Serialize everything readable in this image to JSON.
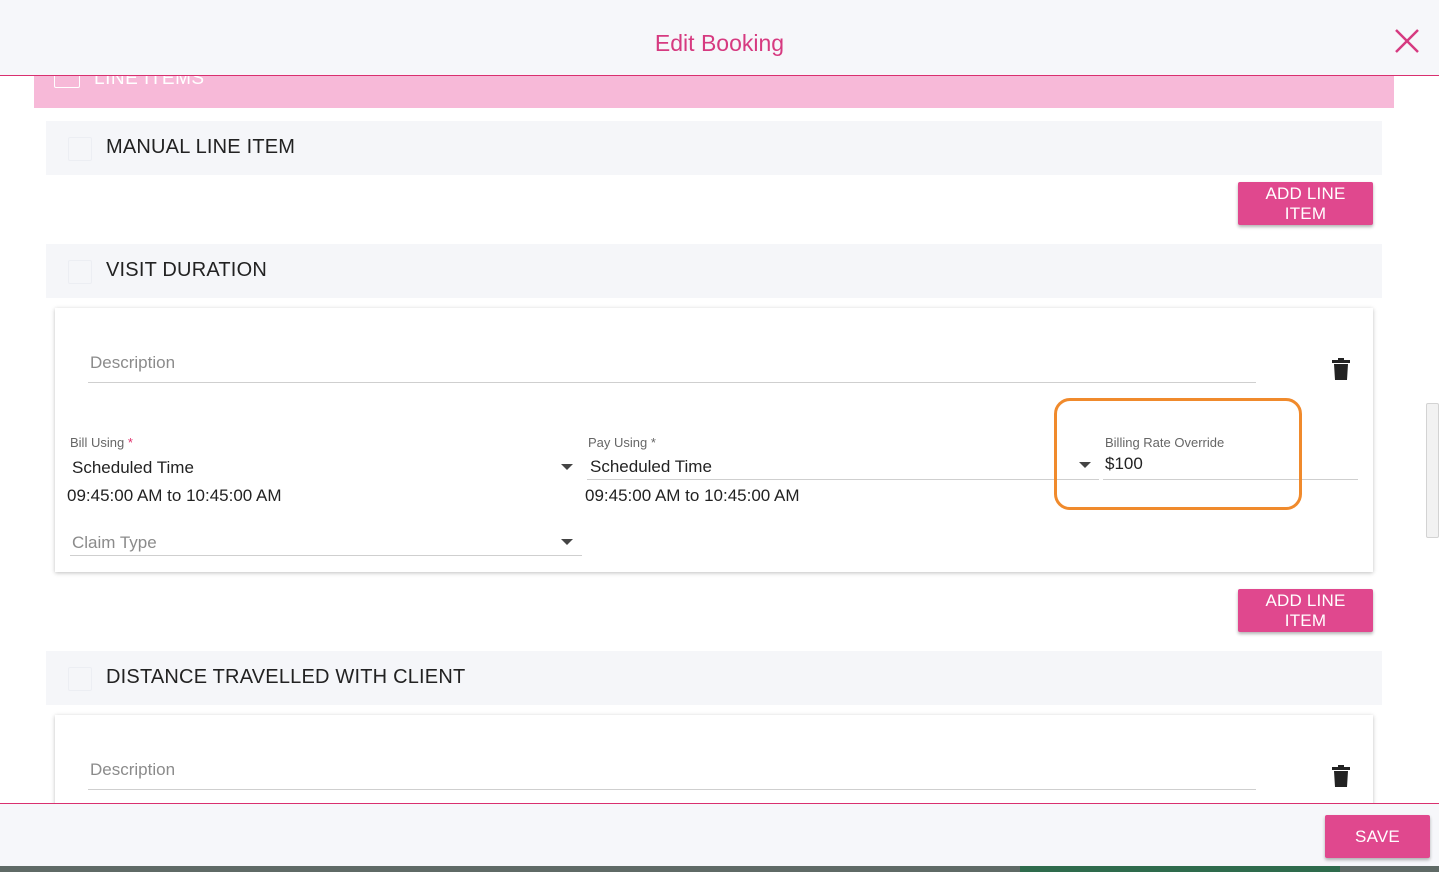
{
  "header": {
    "title": "Edit Booking"
  },
  "line_items_bar": {
    "label": "LINE ITEMS"
  },
  "sections": {
    "manual": {
      "label": "MANUAL LINE ITEM",
      "add_button": "ADD LINE ITEM"
    },
    "visit": {
      "label": "VISIT DURATION",
      "description_placeholder": "Description",
      "bill_using_label": "Bill Using",
      "bill_using_value": "Scheduled Time",
      "bill_using_range": "09:45:00 AM to 10:45:00 AM",
      "pay_using_label": "Pay Using",
      "pay_using_value": "Scheduled Time",
      "pay_using_range": "09:45:00 AM to 10:45:00 AM",
      "billing_rate_label": "Billing Rate Override",
      "billing_rate_value": "$100",
      "claim_type_placeholder": "Claim Type",
      "add_button": "ADD LINE ITEM"
    },
    "distance": {
      "label": "DISTANCE TRAVELLED WITH CLIENT",
      "description_placeholder": "Description"
    }
  },
  "required_marker": "*",
  "footer": {
    "save_label": "SAVE"
  },
  "colors": {
    "accent": "#e0488e",
    "title": "#d63a80",
    "highlight": "#f08a2c",
    "bar": "#f7b9d8"
  },
  "icons": [
    "close-icon",
    "chevron-up-icon",
    "trash-icon",
    "caret-down-icon"
  ]
}
